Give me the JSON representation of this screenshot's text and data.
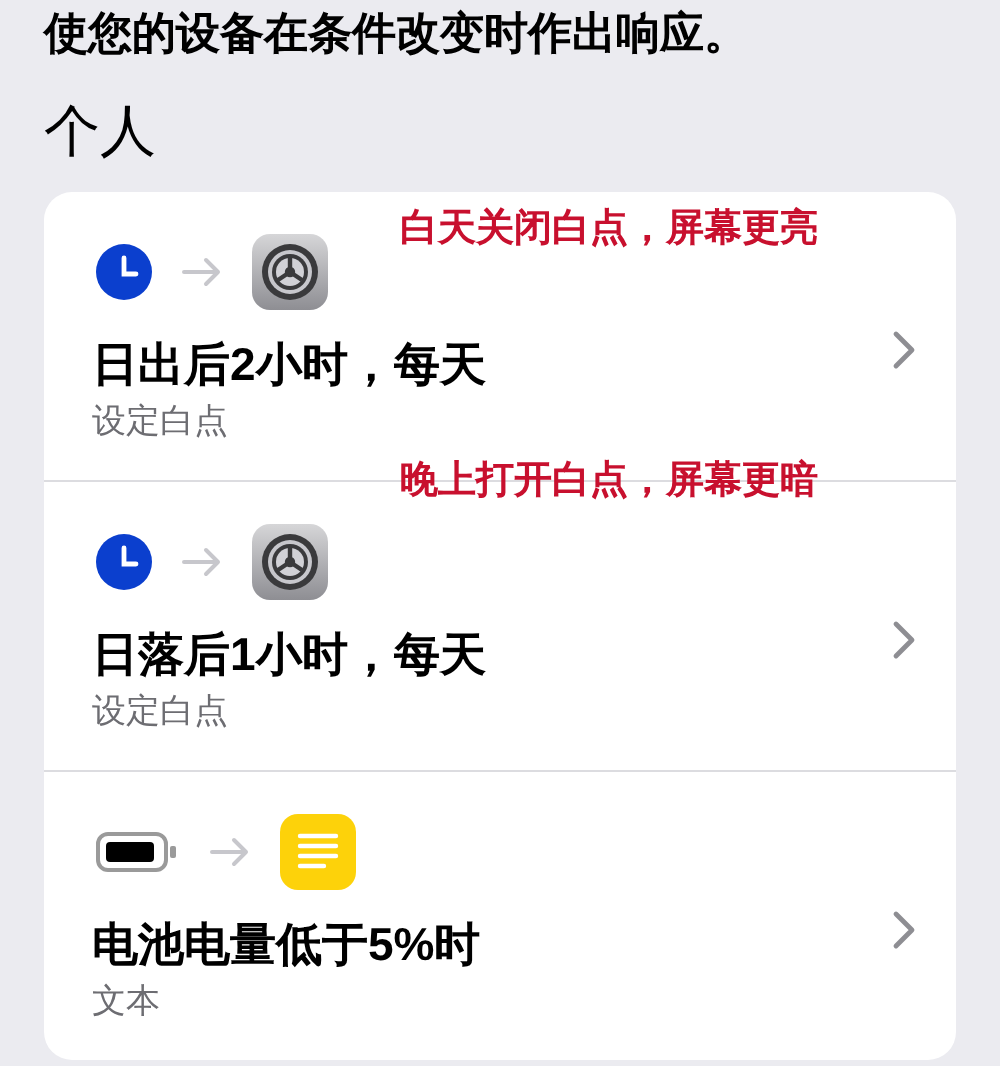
{
  "intro": "使您的设备在条件改变时作出响应。",
  "section_title": "个人",
  "automations": [
    {
      "icons": [
        {
          "kind": "clock"
        },
        {
          "kind": "settings"
        }
      ],
      "title": "日出后2小时，每天",
      "subtitle": "设定白点"
    },
    {
      "icons": [
        {
          "kind": "clock"
        },
        {
          "kind": "settings"
        }
      ],
      "title": "日落后1小时，每天",
      "subtitle": "设定白点"
    },
    {
      "icons": [
        {
          "kind": "battery"
        },
        {
          "kind": "notes"
        }
      ],
      "title": "电池电量低于5%时",
      "subtitle": "文本"
    }
  ],
  "annotations": [
    "白天关闭白点，屏幕更亮",
    "晚上打开白点，屏幕更暗"
  ]
}
